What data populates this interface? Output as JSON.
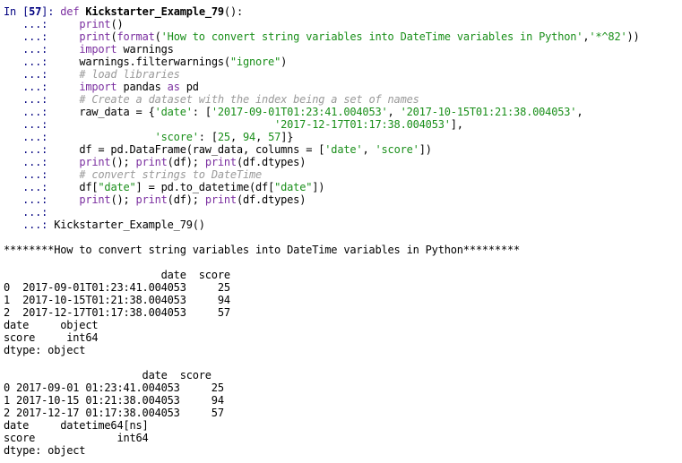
{
  "prompt": {
    "in_label": "In [",
    "cell_number": "57",
    "in_close": "]:",
    "continuation": "   ...:"
  },
  "code": {
    "l1": {
      "kw": "def ",
      "name": "Kickstarter_Example_79",
      "tail": "():"
    },
    "l2": {
      "fn": "print",
      "tail": "()"
    },
    "l3": {
      "fn": "print",
      "a": "(",
      "fn2": "format",
      "b": "(",
      "s1": "'How to convert string variables into DateTime variables in Python'",
      "c": ",",
      "s2": "'*^82'",
      "d": "))"
    },
    "l4": {
      "kw": "import",
      "rest": " warnings"
    },
    "l5": {
      "a": "warnings.filterwarnings(",
      "s": "\"ignore\"",
      "b": ")"
    },
    "l6": {
      "cmt": "# load libraries"
    },
    "l7": {
      "kw": "import",
      "rest": " pandas ",
      "kw2": "as",
      "rest2": " pd"
    },
    "l8": {
      "cmt": "# Create a dataset with the index being a set of names"
    },
    "l9": {
      "a": "raw_data = {",
      "k": "'date'",
      "b": ": [",
      "s1": "'2017-09-01T01:23:41.004053'",
      "c": ", ",
      "s2": "'2017-10-15T01:21:38.004053'",
      "d": ","
    },
    "l10": {
      "indent": "                               ",
      "s": "'2017-12-17T01:17:38.004053'",
      "d": "],"
    },
    "l11": {
      "indent": "            ",
      "k": "'score'",
      "a": ": [",
      "n1": "25",
      "c1": ", ",
      "n2": "94",
      "c2": ", ",
      "n3": "57",
      "b": "]}"
    },
    "l12": {
      "a": "df = pd.DataFrame(raw_data, columns = [",
      "s1": "'date'",
      "c": ", ",
      "s2": "'score'",
      "b": "])"
    },
    "l13": {
      "fn": "print",
      "a": "(); ",
      "fn2": "print",
      "b": "(df); ",
      "fn3": "print",
      "c": "(df.dtypes)"
    },
    "l14": {
      "cmt": "# convert strings to DateTime"
    },
    "l15": {
      "a": "df[",
      "s1": "\"date\"",
      "b": "] = pd.to_datetime(df[",
      "s2": "\"date\"",
      "c": "])"
    },
    "l16": {
      "fn": "print",
      "a": "(); ",
      "fn2": "print",
      "b": "(df); ",
      "fn3": "print",
      "c": "(df.dtypes)"
    },
    "l17": {
      "text": ""
    },
    "l18": {
      "text": "Kickstarter_Example_79()"
    }
  },
  "output": {
    "banner": "********How to convert string variables into DateTime variables in Python*********",
    "df1": {
      "header": "                         date  score",
      "rows": [
        "0  2017-09-01T01:23:41.004053     25",
        "1  2017-10-15T01:21:38.004053     94",
        "2  2017-12-17T01:17:38.004053     57"
      ],
      "dtypes": [
        "date     object",
        "score     int64",
        "dtype: object"
      ]
    },
    "df2": {
      "header": "                      date  score",
      "rows": [
        "0 2017-09-01 01:23:41.004053     25",
        "1 2017-10-15 01:21:38.004053     94",
        "2 2017-12-17 01:17:38.004053     57"
      ],
      "dtypes": [
        "date     datetime64[ns]",
        "score             int64",
        "dtype: object"
      ]
    }
  }
}
